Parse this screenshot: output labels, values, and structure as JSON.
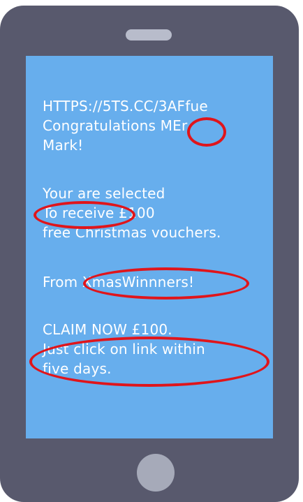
{
  "message": {
    "lines": [
      "HTTPS://5TS.CC/3AFfue",
      "Congratulations MEr",
      "Mark!",
      "Your are selected",
      "To receive £100",
      "free Christmas vouchers.",
      "From XmasWinnners!",
      "CLAIM NOW £100.",
      "Just click on link within",
      "five days."
    ]
  },
  "highlight_color": "#e0151b",
  "screen_color": "#67aeed",
  "phone_color": "#58596d"
}
